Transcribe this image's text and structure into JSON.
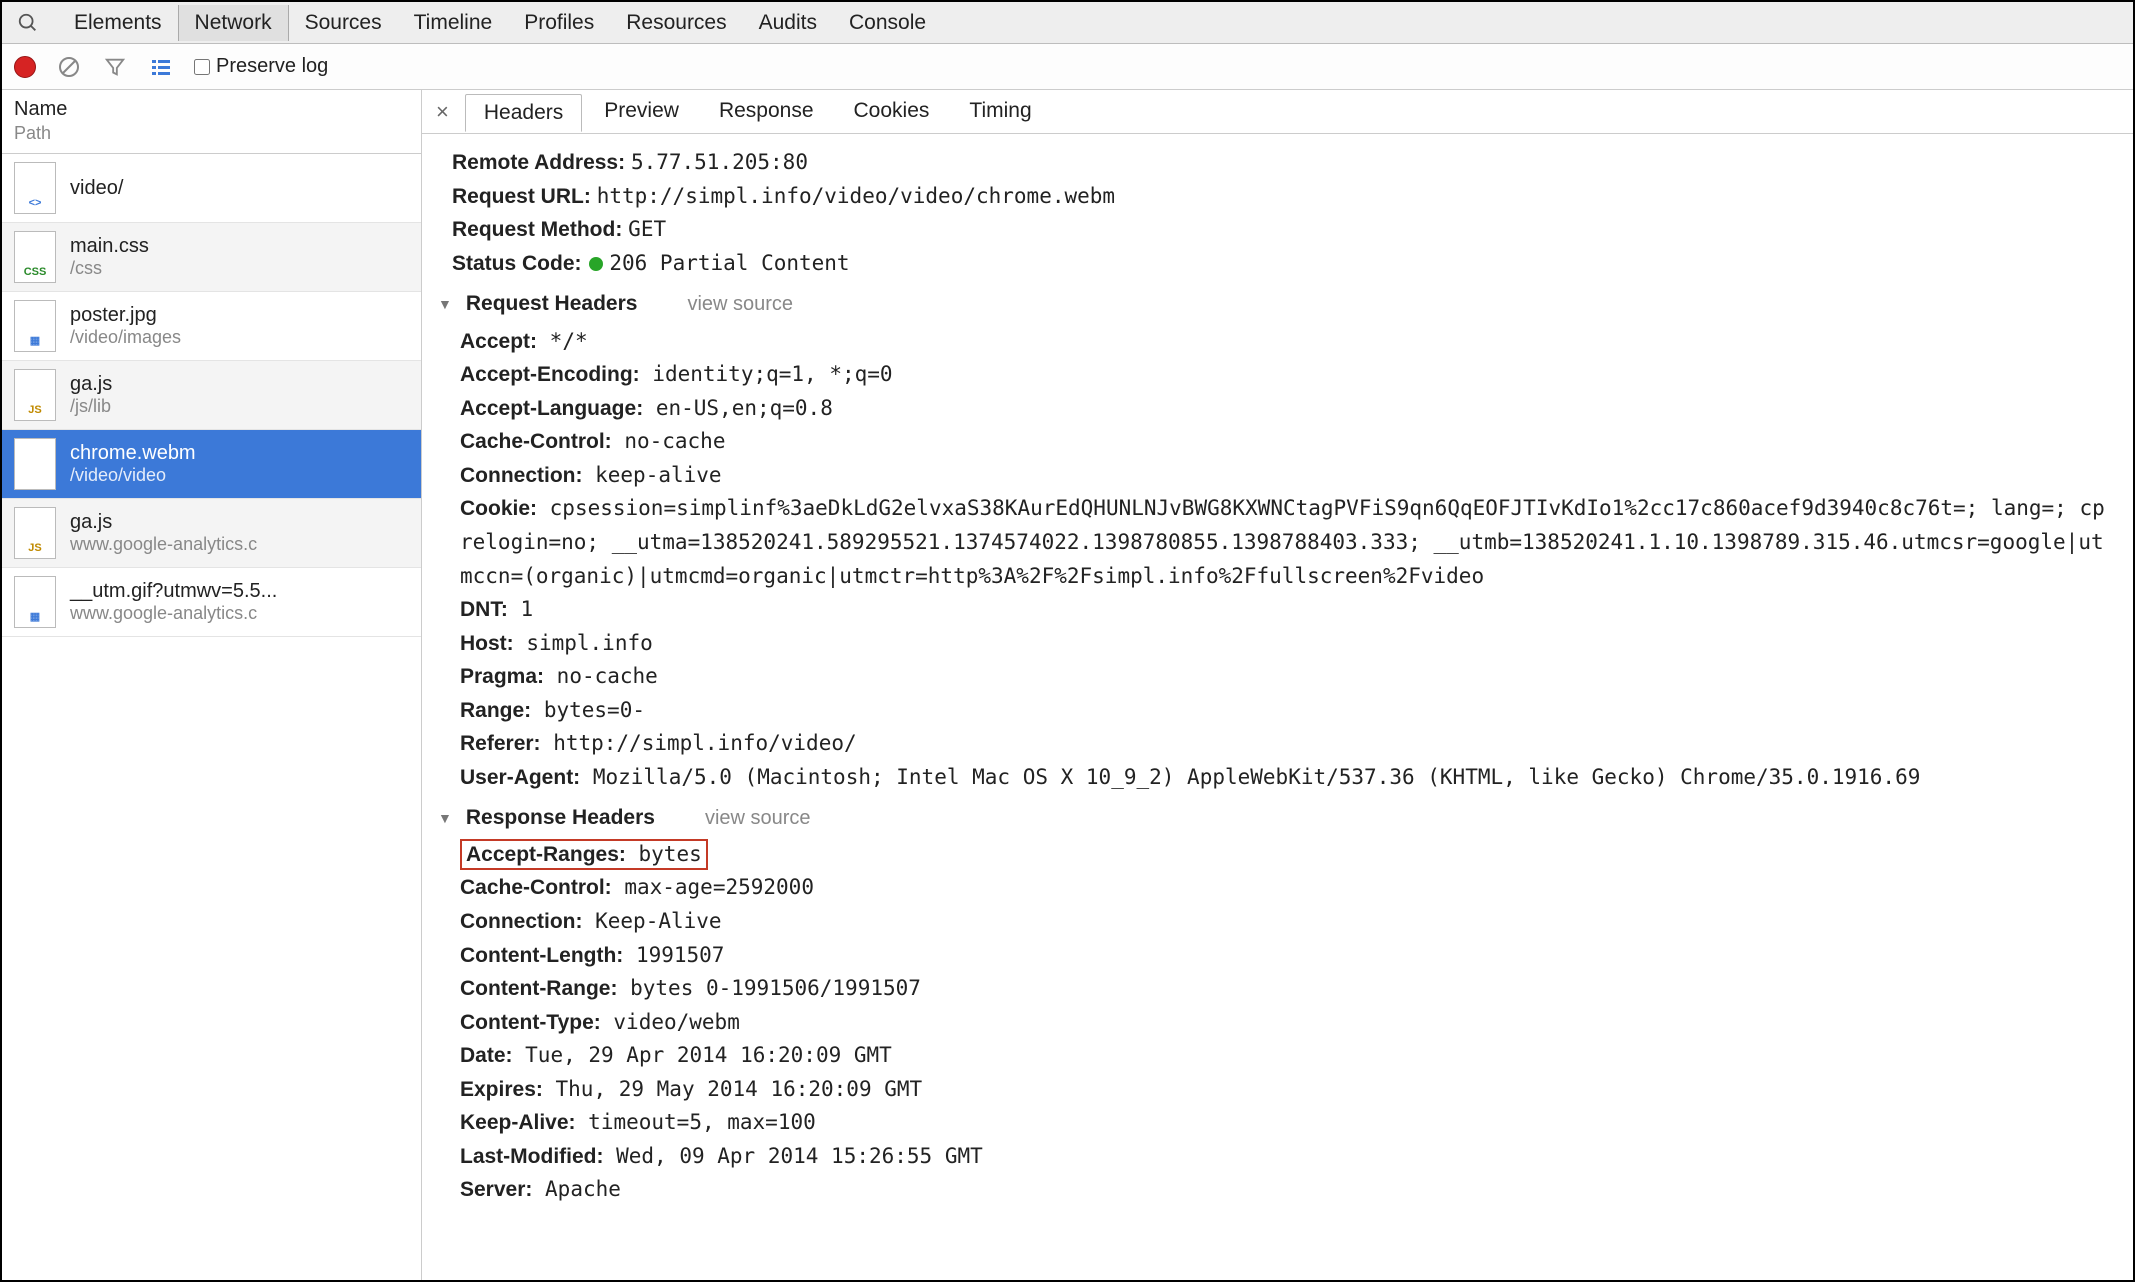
{
  "mainTabs": [
    "Elements",
    "Network",
    "Sources",
    "Timeline",
    "Profiles",
    "Resources",
    "Audits",
    "Console"
  ],
  "mainTabActive": 1,
  "toolbar": {
    "preserve_label": "Preserve log"
  },
  "sidebar": {
    "header_name": "Name",
    "header_path": "Path",
    "items": [
      {
        "icon": "html",
        "name": "video/",
        "path": ""
      },
      {
        "icon": "css",
        "name": "main.css",
        "path": "/css"
      },
      {
        "icon": "img",
        "name": "poster.jpg",
        "path": "/video/images"
      },
      {
        "icon": "js",
        "name": "ga.js",
        "path": "/js/lib"
      },
      {
        "icon": "media",
        "name": "chrome.webm",
        "path": "/video/video",
        "selected": true
      },
      {
        "icon": "js",
        "name": "ga.js",
        "path": "www.google-analytics.c"
      },
      {
        "icon": "img",
        "name": "__utm.gif?utmwv=5.5...",
        "path": "www.google-analytics.c"
      }
    ]
  },
  "detail": {
    "tabs": [
      "Headers",
      "Preview",
      "Response",
      "Cookies",
      "Timing"
    ],
    "tabActive": 0,
    "summary": {
      "remote_address_k": "Remote Address:",
      "remote_address_v": "5.77.51.205:80",
      "request_url_k": "Request URL:",
      "request_url_v": "http://simpl.info/video/video/chrome.webm",
      "request_method_k": "Request Method:",
      "request_method_v": "GET",
      "status_code_k": "Status Code:",
      "status_code_v": "206 Partial Content"
    },
    "req_title": "Request Headers",
    "resp_title": "Response Headers",
    "view_source": "view source",
    "request_headers": [
      {
        "k": "Accept:",
        "v": "*/*"
      },
      {
        "k": "Accept-Encoding:",
        "v": "identity;q=1, *;q=0"
      },
      {
        "k": "Accept-Language:",
        "v": "en-US,en;q=0.8"
      },
      {
        "k": "Cache-Control:",
        "v": "no-cache"
      },
      {
        "k": "Connection:",
        "v": "keep-alive"
      },
      {
        "k": "Cookie:",
        "v": "cpsession=simplinf%3aeDkLdG2elvxaS38KAurEdQHUNLNJvBWG8KXWNCtagPVFiS9qn6QqEOFJTIvKdIo1%2cc17c860acef9d3940c8c76t=; lang=; cprelogin=no; __utma=138520241.589295521.1374574022.1398780855.1398788403.333; __utmb=138520241.1.10.1398789.315.46.utmcsr=google|utmccn=(organic)|utmcmd=organic|utmctr=http%3A%2F%2Fsimpl.info%2Ffullscreen%2Fvideo"
      },
      {
        "k": "DNT:",
        "v": "1"
      },
      {
        "k": "Host:",
        "v": "simpl.info"
      },
      {
        "k": "Pragma:",
        "v": "no-cache"
      },
      {
        "k": "Range:",
        "v": "bytes=0-"
      },
      {
        "k": "Referer:",
        "v": "http://simpl.info/video/"
      },
      {
        "k": "User-Agent:",
        "v": "Mozilla/5.0 (Macintosh; Intel Mac OS X 10_9_2) AppleWebKit/537.36 (KHTML, like Gecko) Chrome/35.0.1916.69"
      }
    ],
    "response_headers": [
      {
        "k": "Accept-Ranges:",
        "v": "bytes",
        "highlight": true
      },
      {
        "k": "Cache-Control:",
        "v": "max-age=2592000"
      },
      {
        "k": "Connection:",
        "v": "Keep-Alive"
      },
      {
        "k": "Content-Length:",
        "v": "1991507"
      },
      {
        "k": "Content-Range:",
        "v": "bytes 0-1991506/1991507"
      },
      {
        "k": "Content-Type:",
        "v": "video/webm"
      },
      {
        "k": "Date:",
        "v": "Tue, 29 Apr 2014 16:20:09 GMT"
      },
      {
        "k": "Expires:",
        "v": "Thu, 29 May 2014 16:20:09 GMT"
      },
      {
        "k": "Keep-Alive:",
        "v": "timeout=5, max=100"
      },
      {
        "k": "Last-Modified:",
        "v": "Wed, 09 Apr 2014 15:26:55 GMT"
      },
      {
        "k": "Server:",
        "v": "Apache"
      }
    ]
  }
}
